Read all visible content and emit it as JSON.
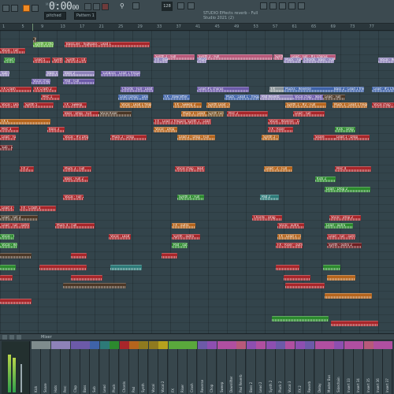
{
  "toolbar": {
    "pattern_label": "Pattern 1",
    "song_position": "0:00",
    "song_position_sub": "00",
    "time_label": "M:S:CS",
    "tempo": "128",
    "mode": "pitched",
    "info_line1": "STUDIO Effects reverb - Full",
    "info_line2": "Studio 2021 (2)"
  },
  "ruler": {
    "bars": [
      "1",
      "5",
      "9",
      "13",
      "17",
      "21",
      "25",
      "29",
      "33",
      "37",
      "41",
      "45",
      "49",
      "53",
      "57",
      "61",
      "65",
      "69",
      "73",
      "77"
    ]
  },
  "clips": [
    {
      "label": "Synth 1",
      "color": "red"
    },
    {
      "label": "Vocal - Full",
      "color": "red"
    },
    {
      "label": "Synth 3 chops",
      "color": "lgreen"
    },
    {
      "label": "Riser",
      "color": "dark"
    },
    {
      "label": "BassLine - highpass - Lead 1",
      "color": "red"
    },
    {
      "label": "Lead 1",
      "color": "grey"
    },
    {
      "label": "Synth 2 - Full",
      "color": "pink"
    },
    {
      "label": "Synth 2 - Full",
      "color": "pink"
    },
    {
      "label": "Synth 2 - Full",
      "color": "pink"
    },
    {
      "label": "Lead - Full - #1 Chorus",
      "color": "pink"
    },
    {
      "label": "Lead 4",
      "color": "green"
    },
    {
      "label": "Lead 5",
      "color": "red"
    },
    {
      "label": "Synth 1 - Ld 21",
      "color": "red"
    },
    {
      "label": "Synth 1 - Ld 21",
      "color": "red"
    },
    {
      "label": "FX - downlifter - #3 Chorus",
      "color": "lilac"
    },
    {
      "label": "Pluck - Full",
      "color": "lilac"
    },
    {
      "label": "Pluck - Full",
      "color": "lilac"
    },
    {
      "label": "Chords - #1",
      "color": "lilac"
    },
    {
      "label": "Bass - Full - #2",
      "color": "lilac"
    },
    {
      "label": "Vocal - Reverse",
      "color": "lilac"
    },
    {
      "label": "Sub bass",
      "color": "lilac"
    },
    {
      "label": "Bass 1",
      "color": "lilac"
    },
    {
      "label": "Bass 2",
      "color": "lilac"
    },
    {
      "label": "SubBass - Lead 1 frequency",
      "color": "purple"
    },
    {
      "label": "Vocal chop - lead",
      "color": "purple"
    },
    {
      "label": "Pad - Full",
      "color": "purple"
    },
    {
      "label": "FX Crash",
      "color": "red"
    },
    {
      "label": "FX Crash 2",
      "color": "red"
    },
    {
      "label": "Chords - Full - Lead 1 frequency",
      "color": "purple"
    },
    {
      "label": "Lead #1 chorus",
      "color": "purple"
    },
    {
      "label": "FX",
      "color": "grey"
    },
    {
      "label": "Plucks - Reverse",
      "color": "blue"
    },
    {
      "label": "Bass 2 - Lead 1 frequency",
      "color": "blue"
    },
    {
      "label": "Lead - #1 Chorus - Full",
      "color": "blue"
    },
    {
      "label": "Perc 1",
      "color": "red"
    },
    {
      "label": "Lead (Drop) - Lead 1 frequency",
      "color": "blue"
    },
    {
      "label": "FX - downlifter",
      "color": "blue"
    },
    {
      "label": "Pluck - Lead 1 - frequency",
      "color": "blue"
    },
    {
      "label": "Pad Reverb",
      "color": "lilac"
    },
    {
      "label": "Vocal chop - lead 2",
      "color": "purple"
    },
    {
      "label": "Lead - Full",
      "color": "dark"
    },
    {
      "label": "Vocal - Lead 1 frequency",
      "color": "red"
    },
    {
      "label": "Synth 5",
      "color": "red"
    },
    {
      "label": "FX - Sweep",
      "color": "red"
    },
    {
      "label": "Vocal - Lead 1 frequency",
      "color": "orange"
    },
    {
      "label": "FX - Sweep 2",
      "color": "orange"
    },
    {
      "label": "Synth Lead - Full - Lead 1 frequency",
      "color": "orange"
    },
    {
      "label": "Synth 1 - #2 - Full",
      "color": "orange"
    },
    {
      "label": "Pluck 1 - Lead 1 frequency",
      "color": "orange"
    },
    {
      "label": "Vocal chop - lead 3",
      "color": "red"
    },
    {
      "label": "Bass - Drop - Full",
      "color": "red"
    },
    {
      "label": "Vocal Riser",
      "color": "dark"
    },
    {
      "label": "Pluck 1 - Lead",
      "color": "orange"
    },
    {
      "label": "Synth Full",
      "color": "brown"
    },
    {
      "label": "Perc 2",
      "color": "red"
    },
    {
      "label": "Lead - Full",
      "color": "red"
    },
    {
      "label": "FX 1",
      "color": "orange"
    },
    {
      "label": "FX - Lead 1 frequency",
      "color": "red"
    },
    {
      "label": "Synth 1 - Lead",
      "color": "red"
    },
    {
      "label": "Vocal - Reverse - Lead 1 frequency",
      "color": "red"
    },
    {
      "label": "Perc 3",
      "color": "red"
    },
    {
      "label": "Bass 3",
      "color": "red"
    },
    {
      "label": "Vocal - Drop",
      "color": "orange"
    },
    {
      "label": "FX - Riser",
      "color": "red"
    },
    {
      "label": "Kick - Drop",
      "color": "green"
    },
    {
      "label": "Lead - Full - Drop",
      "color": "red"
    },
    {
      "label": "Vocal - #3 Drop",
      "color": "red"
    },
    {
      "label": "Pluck 2 - Drop",
      "color": "red"
    },
    {
      "label": "Lead 2 - Drop - Full",
      "color": "orange"
    },
    {
      "label": "Synth 2 - Drop",
      "color": "orange"
    },
    {
      "label": "Snare",
      "color": "red"
    },
    {
      "label": "Lead 1 - Drop",
      "color": "red"
    },
    {
      "label": "Sub - Drop",
      "color": "dred"
    },
    {
      "label": "FX 2",
      "color": "red"
    },
    {
      "label": "Pluck 3 - Full",
      "color": "red"
    },
    {
      "label": "Vocal chop - lead 4",
      "color": "red"
    },
    {
      "label": "Lead - 2 - Full",
      "color": "orange"
    },
    {
      "label": "Perc 4",
      "color": "red"
    },
    {
      "label": "Bass - Full 2",
      "color": "red"
    },
    {
      "label": "Kick 2",
      "color": "green"
    },
    {
      "label": "Lead - Drop 2",
      "color": "green"
    },
    {
      "label": "Vocal - Full 2",
      "color": "red"
    },
    {
      "label": "Synth 3 - Full",
      "color": "green"
    },
    {
      "label": "Pad 2",
      "color": "teal"
    },
    {
      "label": "Lead 3 - Full - Drop",
      "color": "red"
    },
    {
      "label": "FX - Crash 3",
      "color": "red"
    },
    {
      "label": "Lead - Full 3",
      "color": "dark"
    },
    {
      "label": "Chords - Drop",
      "color": "red"
    },
    {
      "label": "Vocal - Drop 2",
      "color": "red"
    },
    {
      "label": "Lead - Full - outro",
      "color": "red"
    },
    {
      "label": "Pluck 4 - Full",
      "color": "red"
    },
    {
      "label": "FX - outro",
      "color": "orange"
    },
    {
      "label": "Vocal - outro",
      "color": "red"
    },
    {
      "label": "Lead - outro",
      "color": "green"
    },
    {
      "label": "Vocal - Full - outro",
      "color": "green"
    },
    {
      "label": "Vocal - Lead 1 - outro",
      "color": "red"
    },
    {
      "label": "Synth - outro",
      "color": "red"
    },
    {
      "label": "FX - Lead 1 - outro",
      "color": "orange"
    },
    {
      "label": "Lead - Full - outro 2",
      "color": "red"
    },
    {
      "label": "Vocal - Reverse - outro",
      "color": "green"
    },
    {
      "label": "Pad - outro",
      "color": "green"
    },
    {
      "label": "FX - Riser - outro",
      "color": "red"
    },
    {
      "label": "Synth - outro 2",
      "color": "dred"
    }
  ],
  "mixer": {
    "title": "Mixer",
    "tracks": [
      {
        "label": "Kick",
        "color": "#7f8c8d"
      },
      {
        "label": "Snare",
        "color": "#7f8c8d"
      },
      {
        "label": "Hats",
        "color": "#8d82b8"
      },
      {
        "label": "Perc",
        "color": "#8d82b8"
      },
      {
        "label": "Clap",
        "color": "#6c5aa8"
      },
      {
        "label": "Bass",
        "color": "#6c5aa8"
      },
      {
        "label": "Sub",
        "color": "#3f63a8"
      },
      {
        "label": "Lead",
        "color": "#2d7a78"
      },
      {
        "label": "Pluck",
        "color": "#2c8a2e"
      },
      {
        "label": "Chords",
        "color": "#a8262a"
      },
      {
        "label": "Pad",
        "color": "#b5651d"
      },
      {
        "label": "Synth",
        "color": "#8f7a1f"
      },
      {
        "label": "Vocal",
        "color": "#8f7a1f"
      },
      {
        "label": "Vocal 2",
        "color": "#b5a21d"
      },
      {
        "label": "FX",
        "color": "#5aa83c"
      },
      {
        "label": "Riser",
        "color": "#5aa83c"
      },
      {
        "label": "Crash",
        "color": "#5aa83c"
      },
      {
        "label": "Reverse",
        "color": "#6c5aa8"
      },
      {
        "label": "Chop",
        "color": "#8d4fb0"
      },
      {
        "label": "Sweep",
        "color": "#b04fa0"
      },
      {
        "label": "Downlifter",
        "color": "#b04fa0"
      },
      {
        "label": "Pad Reverb",
        "color": "#b8597a"
      },
      {
        "label": "Bass 2",
        "color": "#8d4fb0"
      },
      {
        "label": "Lead 2",
        "color": "#b04fa0"
      },
      {
        "label": "Synth 2",
        "color": "#8d4fb0"
      },
      {
        "label": "Pluck 2",
        "color": "#6c5aa8"
      },
      {
        "label": "Vocal 3",
        "color": "#b04fa0"
      },
      {
        "label": "FX 2",
        "color": "#8d4fb0"
      },
      {
        "label": "Reverb",
        "color": "#6c5aa8"
      },
      {
        "label": "Delay",
        "color": "#b04fa0"
      },
      {
        "label": "Master Bus",
        "color": "#b04fa0"
      },
      {
        "label": "Sidechain",
        "color": "#8d4fb0"
      },
      {
        "label": "Insert 33",
        "color": "#b04fa0"
      },
      {
        "label": "Insert 34",
        "color": "#b04fa0"
      },
      {
        "label": "Insert 35",
        "color": "#b8597a"
      },
      {
        "label": "Insert 36",
        "color": "#b04fa0"
      },
      {
        "label": "Insert 37",
        "color": "#b04fa0"
      }
    ]
  },
  "colors": {
    "red": "#a8262a",
    "dred": "#6d1f22",
    "orange": "#b5651d",
    "brown": "#6e4a1c",
    "gold": "#8f7a1f",
    "purple": "#6c5aa8",
    "lilac": "#8d82b8",
    "pink": "#b8597a",
    "green": "#2c8a2e",
    "lgreen": "#5aa83c",
    "teal": "#2d7a78",
    "blue": "#3f63a8",
    "grey": "#8c959a",
    "dark": "#4b3726",
    "accent": "#f08a24"
  }
}
